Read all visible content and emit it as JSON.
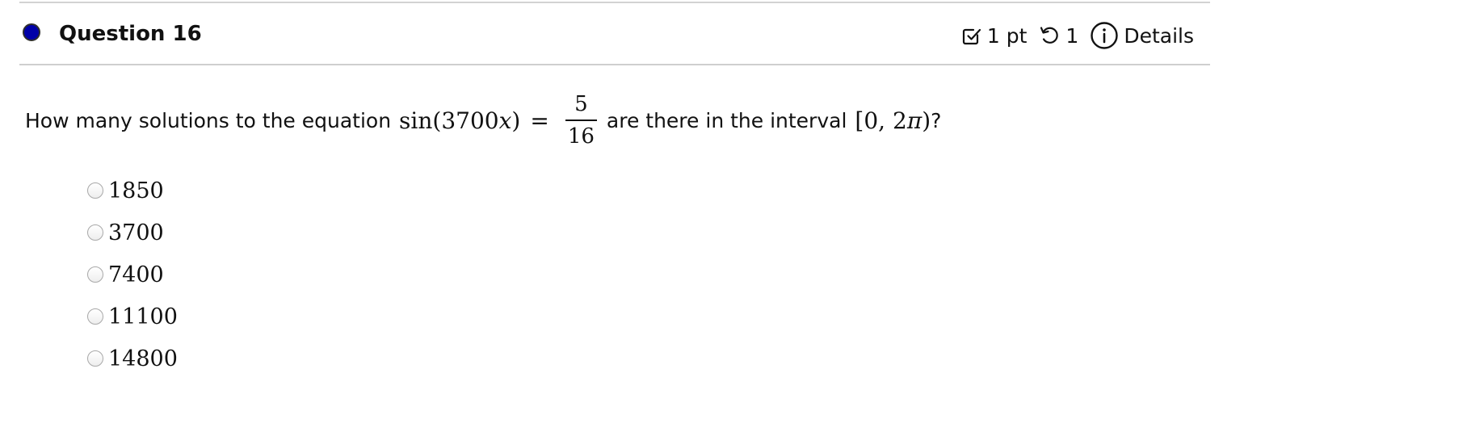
{
  "question": {
    "title": "Question 16",
    "points": "1 pt",
    "attempts": "1",
    "details_label": "Details",
    "status_color": "#0000a8"
  },
  "prompt": {
    "text_before": "How many solutions to the equation",
    "func": "sin",
    "open_paren": "(",
    "coefficient": "3700",
    "variable": "x",
    "close_paren": ")",
    "equals": "=",
    "fraction_numerator": "5",
    "fraction_denominator": "16",
    "text_middle": "are there in the interval",
    "interval_open": "[",
    "interval_start": "0",
    "interval_comma": ",",
    "interval_end_coef": "2",
    "interval_end_symbol": "π",
    "interval_close": ")",
    "question_mark": "?"
  },
  "options": [
    {
      "label": "1850"
    },
    {
      "label": "3700"
    },
    {
      "label": "7400"
    },
    {
      "label": "11100"
    },
    {
      "label": "14800"
    }
  ]
}
